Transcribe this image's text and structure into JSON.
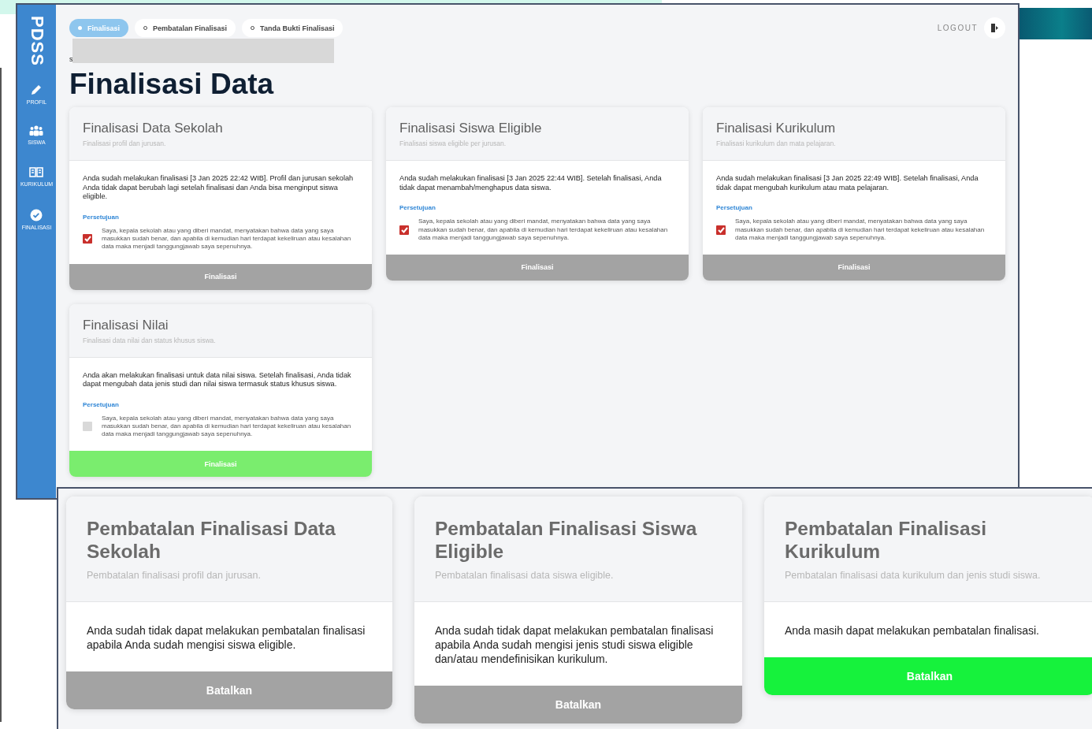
{
  "sidebar": {
    "logo": "PDSS",
    "items": [
      {
        "label": "PROFIL",
        "kind": "pencil"
      },
      {
        "label": "SISWA",
        "kind": "users"
      },
      {
        "label": "KURIKULUM",
        "kind": "book"
      },
      {
        "label": "FINALISASI",
        "kind": "check"
      }
    ]
  },
  "tabs": [
    {
      "label": "Finalisasi",
      "selected": true
    },
    {
      "label": "Pembatalan Finalisasi",
      "selected": false
    },
    {
      "label": "Tanda Bukti Finalisasi",
      "selected": false
    }
  ],
  "logout": "LOGOUT",
  "breadcrumb": "s",
  "title": "Finalisasi Data",
  "cards": [
    {
      "title": "Finalisasi Data Sekolah",
      "subtitle": "Finalisasi profil dan jurusan.",
      "body": "Anda sudah melakukan finalisasi [3 Jan 2025 22:42 WIB]. Profil dan jurusan sekolah Anda tidak dapat berubah lagi setelah finalisasi dan Anda bisa menginput siswa eligible.",
      "consent_label": "Persetujuan",
      "consent_text": "Saya, kepala sekolah atau yang diberi mandat, menyatakan bahwa data yang saya masukkan sudah benar, dan apabila di kemudian hari terdapat kekeliruan atau kesalahan data maka menjadi tanggungjawab saya sepenuhnya.",
      "checked": true,
      "button": "Finalisasi",
      "enabled": false
    },
    {
      "title": "Finalisasi Siswa Eligible",
      "subtitle": "Finalisasi siswa eligible per jurusan.",
      "body": "Anda sudah melakukan finalisasi [3 Jan 2025 22:44 WIB]. Setelah finalisasi, Anda tidak dapat menambah/menghapus data siswa.",
      "consent_label": "Persetujuan",
      "consent_text": "Saya, kepala sekolah atau yang diberi mandat, menyatakan bahwa data yang saya masukkan sudah benar, dan apabila di kemudian hari terdapat kekeliruan atau kesalahan data maka menjadi tanggungjawab saya sepenuhnya.",
      "checked": true,
      "button": "Finalisasi",
      "enabled": false
    },
    {
      "title": "Finalisasi Kurikulum",
      "subtitle": "Finalisasi kurikulum dan mata pelajaran.",
      "body": "Anda sudah melakukan finalisasi [3 Jan 2025 22:49 WIB]. Setelah finalisasi, Anda tidak dapat mengubah kurikulum atau mata pelajaran.",
      "consent_label": "Persetujuan",
      "consent_text": "Saya, kepala sekolah atau yang diberi mandat, menyatakan bahwa data yang saya masukkan sudah benar, dan apabila di kemudian hari terdapat kekeliruan atau kesalahan data maka menjadi tanggungjawab saya sepenuhnya.",
      "checked": true,
      "button": "Finalisasi",
      "enabled": false
    },
    {
      "title": "Finalisasi Nilai",
      "subtitle": "Finalisasi data nilai dan status khusus siswa.",
      "body": "Anda akan melakukan finalisasi untuk data nilai siswa. Setelah finalisasi, Anda tidak dapat mengubah data jenis studi dan nilai siswa termasuk status khusus siswa.",
      "consent_label": "Persetujuan",
      "consent_text": "Saya, kepala sekolah atau yang diberi mandat, menyatakan bahwa data yang saya masukkan sudah benar, dan apabila di kemudian hari terdapat kekeliruan atau kesalahan data maka menjadi tanggungjawab saya sepenuhnya.",
      "checked": false,
      "button": "Finalisasi",
      "enabled": true
    }
  ],
  "cancel_cards": [
    {
      "title": "Pembatalan Finalisasi Data Sekolah",
      "subtitle": "Pembatalan finalisasi profil dan jurusan.",
      "body": "Anda sudah tidak dapat melakukan pembatalan finalisasi apabila Anda sudah mengisi siswa eligible.",
      "button": "Batalkan",
      "enabled": false
    },
    {
      "title": "Pembatalan Finalisasi Siswa Eligible",
      "subtitle": "Pembatalan finalisasi data siswa eligible.",
      "body": "Anda sudah tidak dapat melakukan pembatalan finalisasi apabila Anda sudah mengisi jenis studi siswa eligible dan/atau mendefinisikan kurikulum.",
      "button": "Batalkan",
      "enabled": false
    },
    {
      "title": "Pembatalan Finalisasi Kurikulum",
      "subtitle": "Pembatalan finalisasi data kurikulum dan jenis studi siswa.",
      "body": "Anda masih dapat melakukan pembatalan finalisasi.",
      "button": "Batalkan",
      "enabled": true
    }
  ]
}
